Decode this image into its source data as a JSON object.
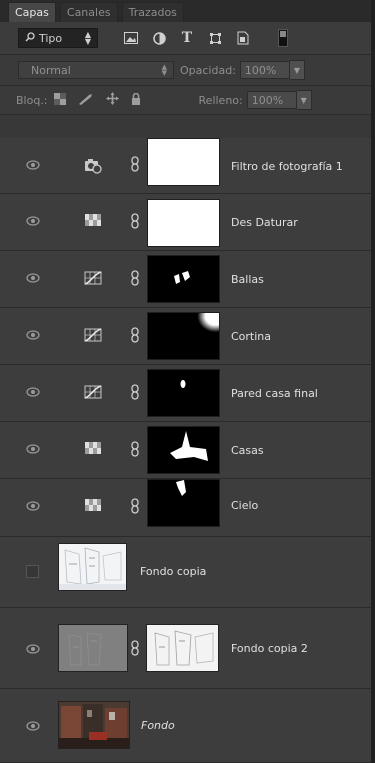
{
  "tabs": [
    "Capas",
    "Canales",
    "Trazados"
  ],
  "filter": {
    "kind_label": "Tipo",
    "kind_icon": "search-icon"
  },
  "blend": {
    "mode": "Normal",
    "opacity_label": "Opacidad:",
    "opacity": "100%",
    "lock_label": "Bloq.:",
    "fill_label": "Relleno:",
    "fill": "100%"
  },
  "layers": [
    {
      "name": "Filtro de fotografía 1",
      "type": "adjustment",
      "icon": "photo-filter-icon",
      "mask": "white",
      "visible": true
    },
    {
      "name": "Des Daturar",
      "type": "adjustment",
      "icon": "hue-saturation-icon",
      "mask": "white",
      "visible": true
    },
    {
      "name": "Ballas",
      "type": "adjustment",
      "icon": "curves-icon",
      "mask": "black",
      "visible": true
    },
    {
      "name": "Cortina",
      "type": "adjustment",
      "icon": "curves-icon",
      "mask": "black",
      "visible": true
    },
    {
      "name": "Pared casa final",
      "type": "adjustment",
      "icon": "curves-icon",
      "mask": "black",
      "visible": true
    },
    {
      "name": "Casas",
      "type": "adjustment",
      "icon": "hue-saturation-icon",
      "mask": "black",
      "visible": true
    },
    {
      "name": "Cielo",
      "type": "adjustment",
      "icon": "hue-saturation-icon",
      "mask": "black",
      "visible": true
    },
    {
      "name": "Fondo copia",
      "type": "pixel",
      "visible": false
    },
    {
      "name": "Fondo copia 2",
      "type": "pixel-masked",
      "visible": true
    },
    {
      "name": "Fondo",
      "type": "background",
      "visible": true
    }
  ]
}
